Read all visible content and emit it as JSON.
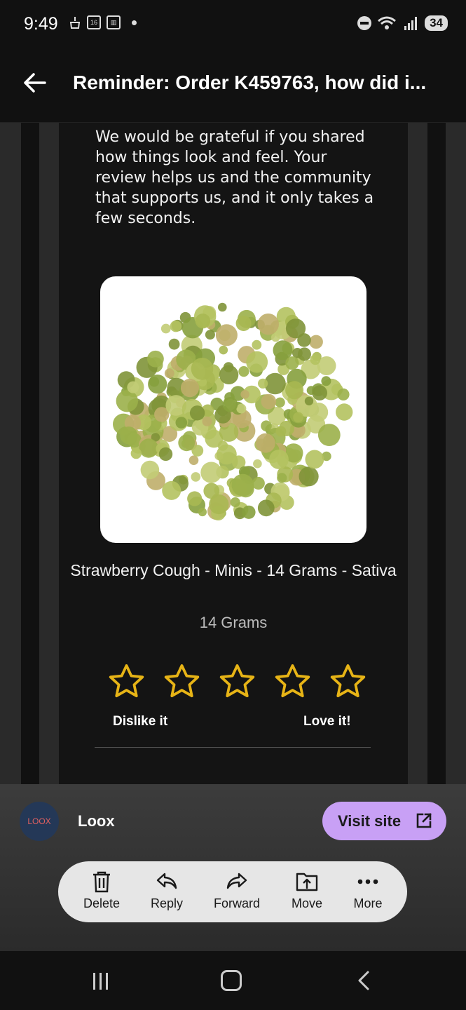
{
  "status_bar": {
    "time": "9:49",
    "battery": "34"
  },
  "header": {
    "title": "Reminder: Order K459763, how did i..."
  },
  "email": {
    "paragraph": "We would be grateful if you shared how things look and feel. Your review helps us and the community that supports us, and it only takes a few seconds.",
    "product_name": "Strawberry Cough - Minis - 14 Grams - Sativa",
    "variant": "14 Grams",
    "rating": {
      "label_low": "Dislike it",
      "label_high": "Love it!",
      "max_stars": 5,
      "selected": 0
    },
    "accent_color": "#E7B416"
  },
  "sender": {
    "avatar_text": "LOOX",
    "name": "Loox",
    "visit_label": "Visit site",
    "visit_color": "#C8A0F5"
  },
  "actions": [
    {
      "label": "Delete",
      "icon": "trash-icon"
    },
    {
      "label": "Reply",
      "icon": "reply-icon"
    },
    {
      "label": "Forward",
      "icon": "forward-icon"
    },
    {
      "label": "Move",
      "icon": "move-icon"
    },
    {
      "label": "More",
      "icon": "more-icon"
    }
  ]
}
